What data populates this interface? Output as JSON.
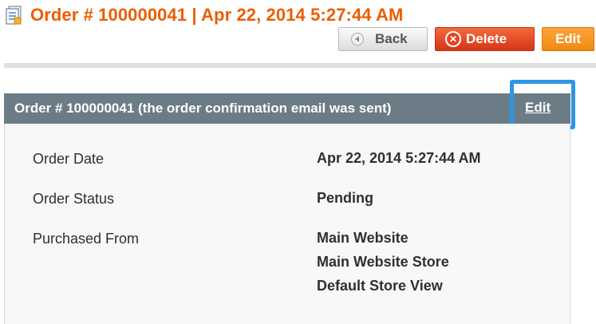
{
  "header": {
    "title": "Order # 100000041 | Apr 22, 2014 5:27:44 AM",
    "buttons": {
      "back": "Back",
      "delete": "Delete",
      "edit": "Edit"
    }
  },
  "panel": {
    "title": "Order # 100000041 (the order confirmation email was sent)",
    "edit_link": "Edit",
    "rows": [
      {
        "label": "Order Date",
        "values": [
          "Apr 22, 2014 5:27:44 AM"
        ]
      },
      {
        "label": "Order Status",
        "values": [
          "Pending"
        ]
      },
      {
        "label": "Purchased From",
        "values": [
          "Main Website",
          "Main Website Store",
          "Default Store View"
        ]
      }
    ]
  },
  "colors": {
    "title_orange": "#eb5e00",
    "panel_header": "#6b7c87",
    "highlight_blue": "#2a96e8",
    "delete_red": "#e8441f",
    "edit_orange": "#f59a1d"
  },
  "icons": {
    "title": "order-document-icon",
    "back": "back-arrow-icon",
    "delete": "delete-x-icon"
  }
}
